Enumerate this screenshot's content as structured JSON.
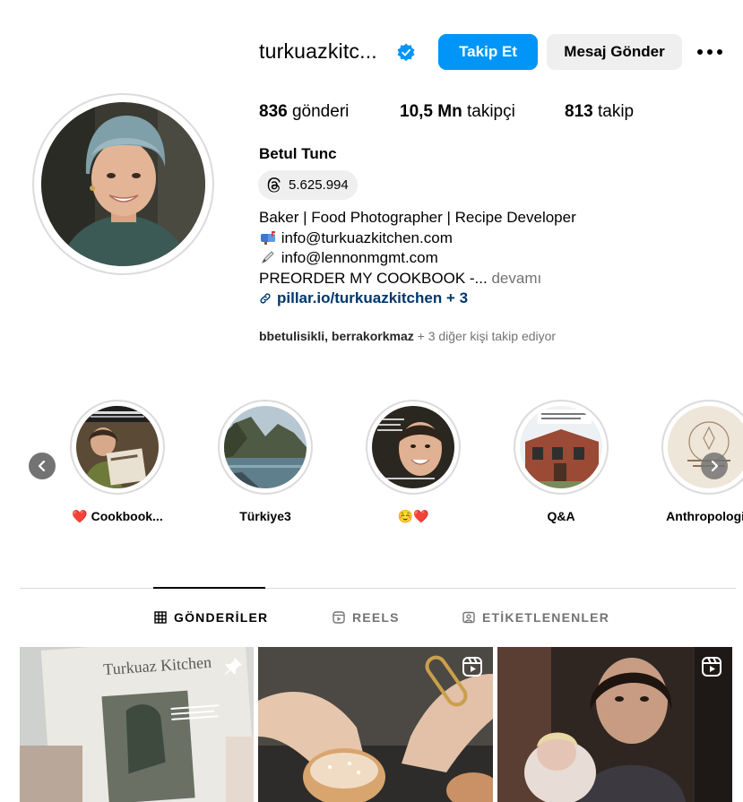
{
  "profile": {
    "username": "turkuazkitc...",
    "full_name": "Betul Tunc",
    "threads_count": "5.625.994",
    "stats": {
      "posts_count": "836",
      "posts_label": "gönderi",
      "followers_count": "10,5 Mn",
      "followers_label": "takipçi",
      "following_count": "813",
      "following_label": "takip"
    },
    "bio": {
      "line1": "Baker | Food Photographer | Recipe Developer",
      "line2_emoji": "📬",
      "line2": "info@turkuazkitchen.com",
      "line3_emoji": "🖊",
      "line3": "info@lennonmgmt.com",
      "line4": "PREORDER MY COOKBOOK -...",
      "more": "devamı",
      "link": "pillar.io/turkuazkitchen + 3"
    },
    "followed_by": {
      "names": "bbetulisikli, berrakorkmaz",
      "rest": "+ 3 diğer kişi takip ediyor"
    }
  },
  "actions": {
    "follow_label": "Takip Et",
    "message_label": "Mesaj Gönder"
  },
  "highlights": [
    {
      "label": "❤️ Cookbook..."
    },
    {
      "label": "Türkiye3"
    },
    {
      "label": "☺️❤️"
    },
    {
      "label": "Q&A"
    },
    {
      "label": "Anthropologie"
    }
  ],
  "tabs": [
    {
      "label": "GÖNDERİLER",
      "icon": "grid-icon",
      "active": true
    },
    {
      "label": "REELS",
      "icon": "reels-icon",
      "active": false
    },
    {
      "label": "ETİKETLENENLER",
      "icon": "tagged-icon",
      "active": false
    }
  ],
  "posts": [
    {
      "icon": "pin-icon",
      "cover_title": "Turkuaz Kitchen"
    },
    {
      "icon": "reels-icon"
    },
    {
      "icon": "reels-icon"
    }
  ],
  "colors": {
    "accent": "#0095f6",
    "secondary_button": "#efefef",
    "link": "#00376b",
    "muted_text": "#737373",
    "verified": "#0095f6"
  }
}
